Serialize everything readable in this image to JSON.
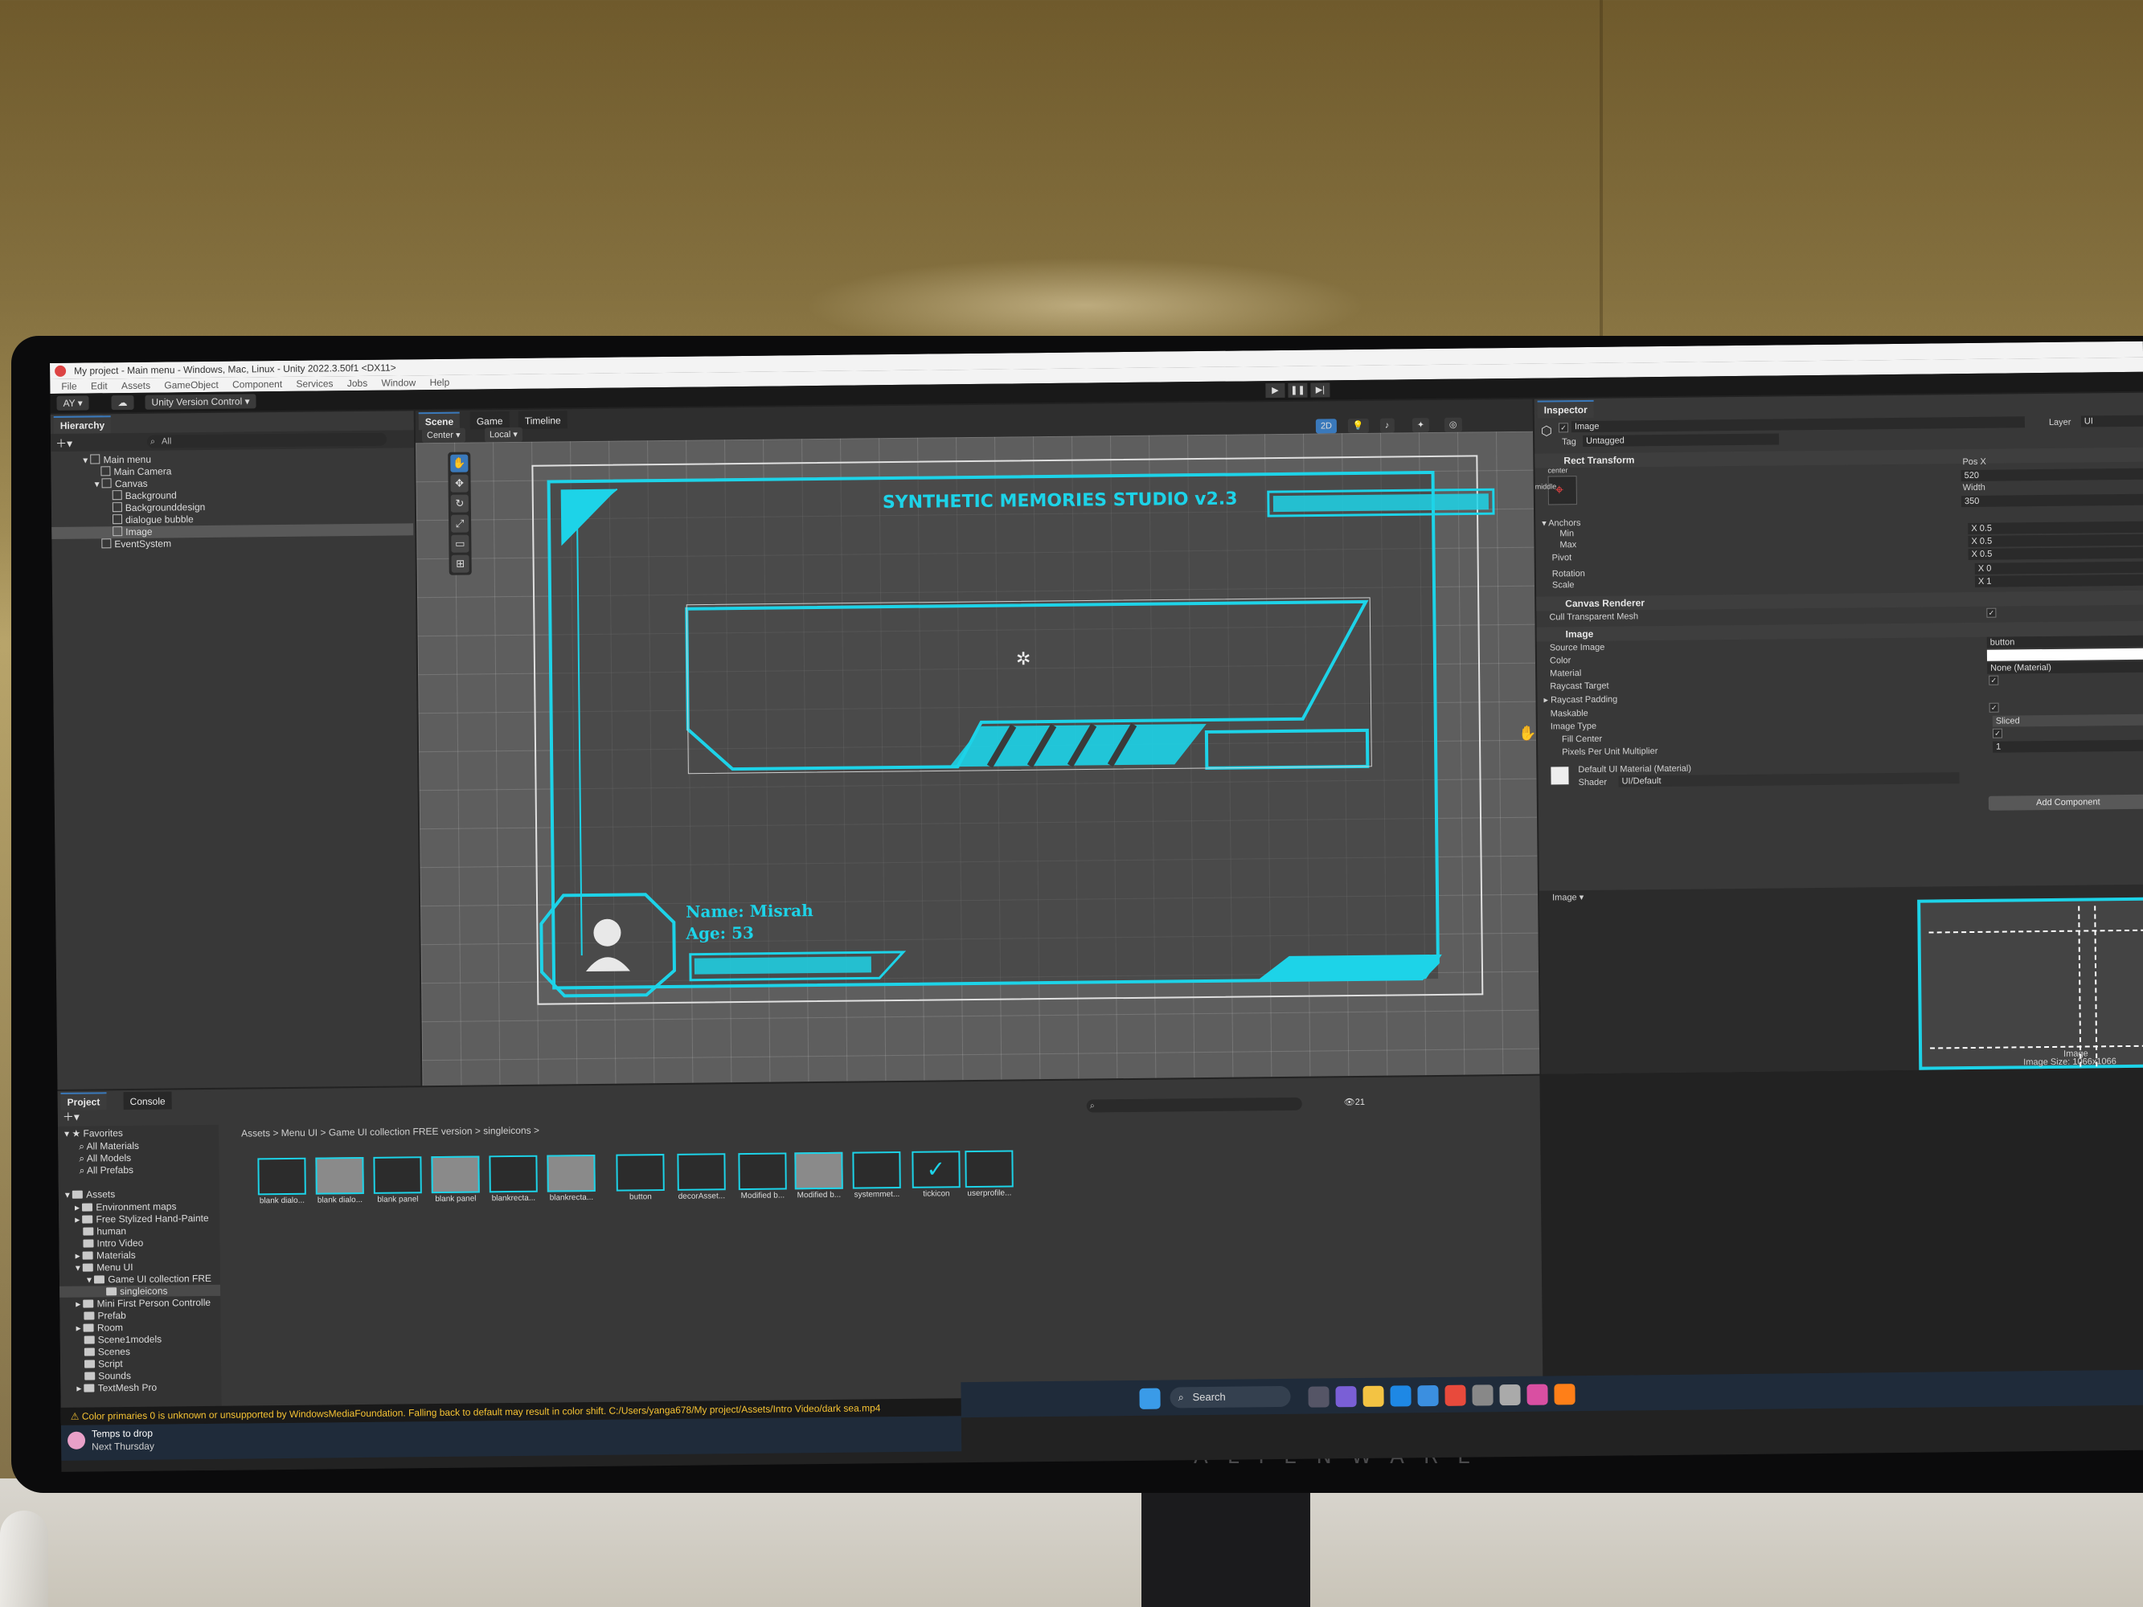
{
  "window": {
    "title": "My project - Main menu - Windows, Mac, Linux - Unity 2022.3.50f1 <DX11>",
    "menu": [
      "File",
      "Edit",
      "Assets",
      "GameObject",
      "Component",
      "Services",
      "Jobs",
      "Window",
      "Help"
    ],
    "account": "AY",
    "version_control": "Unity Version Control"
  },
  "hierarchy": {
    "tab": "Hierarchy",
    "search": "All",
    "items": [
      {
        "label": "Main menu"
      },
      {
        "label": "Main Camera"
      },
      {
        "label": "Canvas"
      },
      {
        "label": "Background"
      },
      {
        "label": "Backgrounddesign"
      },
      {
        "label": "dialogue bubble"
      },
      {
        "label": "Image"
      },
      {
        "label": "EventSystem"
      }
    ]
  },
  "scene": {
    "tabs": [
      "Scene",
      "Game",
      "Timeline"
    ],
    "pivot": "Center",
    "space": "Local",
    "mode_2d": "2D",
    "canvas": {
      "title": "SYNTHETIC MEMORIES STUDIO v2.3",
      "name": "Name: Misrah",
      "age": "Age: 53"
    },
    "colors": {
      "accent": "#1dd3e8",
      "grid_bg": "#5e5e5e",
      "canvas_bg": "#3a3a3a"
    }
  },
  "inspector": {
    "tab": "Inspector",
    "object_name": "Image",
    "tag_label": "Tag",
    "tag": "Untagged",
    "layer_label": "Layer",
    "layer": "UI",
    "rect": {
      "header": "Rect Transform",
      "anchor_h": "center",
      "anchor_v": "middle",
      "posx_label": "Pos X",
      "posx": "520",
      "width_label": "Width",
      "width": "350",
      "anchors": "Anchors",
      "min": "Min",
      "max": "Max",
      "pivot": "Pivot",
      "rotation": "Rotation",
      "scale": "Scale",
      "min_x": "0.5",
      "max_x": "0.5",
      "pivot_x": "0.5",
      "rotation_x": "0",
      "scale_x": "1"
    },
    "canvas_renderer": {
      "header": "Canvas Renderer",
      "cull": "Cull Transparent Mesh"
    },
    "image": {
      "header": "Image",
      "source_label": "Source Image",
      "source": "button",
      "color_label": "Color",
      "material_label": "Material",
      "material": "None (Material)",
      "raycast_target": "Raycast Target",
      "raycast_padding": "Raycast Padding",
      "maskable": "Maskable",
      "image_type_label": "Image Type",
      "image_type": "Sliced",
      "fill_center": "Fill Center",
      "ppu_label": "Pixels Per Unit Multiplier",
      "ppu": "1"
    },
    "material": {
      "name": "Default UI Material (Material)",
      "shader_label": "Shader",
      "shader": "UI/Default"
    },
    "add_component": "Add Component",
    "preview_label": "Image",
    "preview_caption": "Image",
    "preview_size": "Image Size: 1066x1066"
  },
  "project": {
    "tabs": [
      "Project",
      "Console"
    ],
    "count": "21",
    "breadcrumb": [
      "Assets",
      "Menu UI",
      "Game UI collection FREE version",
      "singleicons"
    ],
    "favorites": {
      "label": "Favorites",
      "items": [
        "All Materials",
        "All Models",
        "All Prefabs"
      ]
    },
    "assets_label": "Assets",
    "tree": [
      "Environment maps",
      "Free Stylized Hand-Painte",
      "human",
      "Intro Video",
      "Materials",
      "Menu UI",
      "Game UI collection FRE",
      "singleicons",
      "Mini First Person Controlle",
      "Prefab",
      "Room",
      "Scene1models",
      "Scenes",
      "Script",
      "Sounds",
      "TextMesh Pro"
    ],
    "assets": [
      "blank dialo...",
      "blank dialo...",
      "blank panel",
      "blank panel",
      "blankrecta...",
      "blankrecta...",
      "button",
      "decorAsset...",
      "Modified b...",
      "Modified b...",
      "systemmet...",
      "tickicon",
      "userprofile..."
    ]
  },
  "status": {
    "warning": "Color primaries 0 is unknown or unsupported by WindowsMediaFoundation. Falling back to default may result in color shift. C:/Users/yanga678/My project/Assets/Intro Video/dark sea.mp4"
  },
  "taskbar": {
    "search": "Search",
    "weather_line1": "Temps to drop",
    "weather_line2": "Next Thursday"
  },
  "monitor": {
    "brand": "ALIENWARE"
  }
}
